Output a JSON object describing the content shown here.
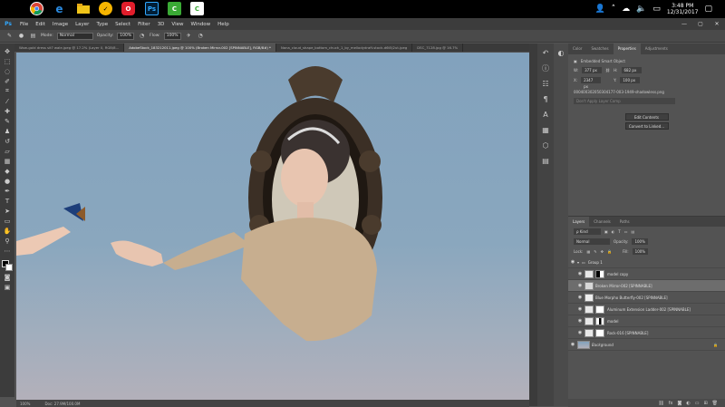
{
  "taskbar": {
    "apps": [
      {
        "name": "chrome-icon",
        "label": "",
        "color": "#1a73e8"
      },
      {
        "name": "edge-icon",
        "label": "e",
        "color": "#0078d7"
      },
      {
        "name": "file-explorer-icon",
        "label": "",
        "color": "#f0c419"
      },
      {
        "name": "norton-icon",
        "label": "✓",
        "color": "#f7b500"
      },
      {
        "name": "opera-icon",
        "label": "O",
        "color": "#e11d2b"
      },
      {
        "name": "photoshop-icon",
        "label": "Ps",
        "color": "#001e36"
      },
      {
        "name": "camtasia-icon",
        "label": "C",
        "color": "#3aaa35"
      },
      {
        "name": "camtasia-recorder-icon",
        "label": "C",
        "color": "#ffffff"
      }
    ],
    "time": "3:48 PM",
    "date": "12/31/2017"
  },
  "menu": [
    "File",
    "Edit",
    "Image",
    "Layer",
    "Type",
    "Select",
    "Filter",
    "3D",
    "View",
    "Window",
    "Help"
  ],
  "options": {
    "mode_label": "Mode:",
    "mode_value": "Normal",
    "opacity_label": "Opacity:",
    "opacity_value": "100%",
    "flow_label": "Flow:",
    "flow_value": "100%"
  },
  "tabs": [
    "Wow-gold dress sit? wale.jpeg @ 17.2% (Layer 0, RGB/8...",
    "AdobeStock_183212011.jpeg @ 100% (Broken Mirror-002 [SPINNABLE], RGB/8#) *",
    "Nana_cloud_shape_bottom_chuck_1_by_mellodydraft.stock-d6t5j2ut.jpeg",
    "DSC_7128.jpg @ 16.7%"
  ],
  "status": {
    "zoom": "100%",
    "doc": "Doc: 27.9M/100.0M"
  },
  "properties": {
    "tabs": [
      "Color",
      "Swatches",
      "Properties",
      "Adjustments"
    ],
    "title": "Embedded Smart Object",
    "w_label": "W:",
    "w_value": "377 px",
    "h_label": "H:",
    "h_value": "682 px",
    "x_label": "X:",
    "x_value": "2347 px",
    "y_label": "Y:",
    "y_value": "100 px",
    "filename": "000400302050304177-003-1949-shadowless.png",
    "comp_placeholder": "Don't Apply Layer Comp",
    "edit_button": "Edit Contents",
    "convert_button": "Convert to Linked..."
  },
  "layers_panel": {
    "tabs": [
      "Layers",
      "Channels",
      "Paths"
    ],
    "kind_label": "ρ Kind",
    "blend_mode": "Normal",
    "opacity_label": "Opacity:",
    "opacity_value": "100%",
    "lock_label": "Lock:",
    "fill_label": "Fill:",
    "fill_value": "100%",
    "layers": [
      {
        "name": "Group 1",
        "type": "group"
      },
      {
        "name": "model copy",
        "type": "layer"
      },
      {
        "name": "Broken Mirror-002 [SPINNABLE]",
        "type": "layer",
        "selected": true
      },
      {
        "name": "Blue Morpho Butterfly-002 [SPINNABLE]",
        "type": "layer"
      },
      {
        "name": "Aluminum Extension Ladder-002 [SPINNABLE]",
        "type": "layer"
      },
      {
        "name": "model",
        "type": "layer"
      },
      {
        "name": "Rock-016 [SPINNABLE]",
        "type": "layer"
      },
      {
        "name": "Background",
        "type": "background"
      }
    ]
  }
}
